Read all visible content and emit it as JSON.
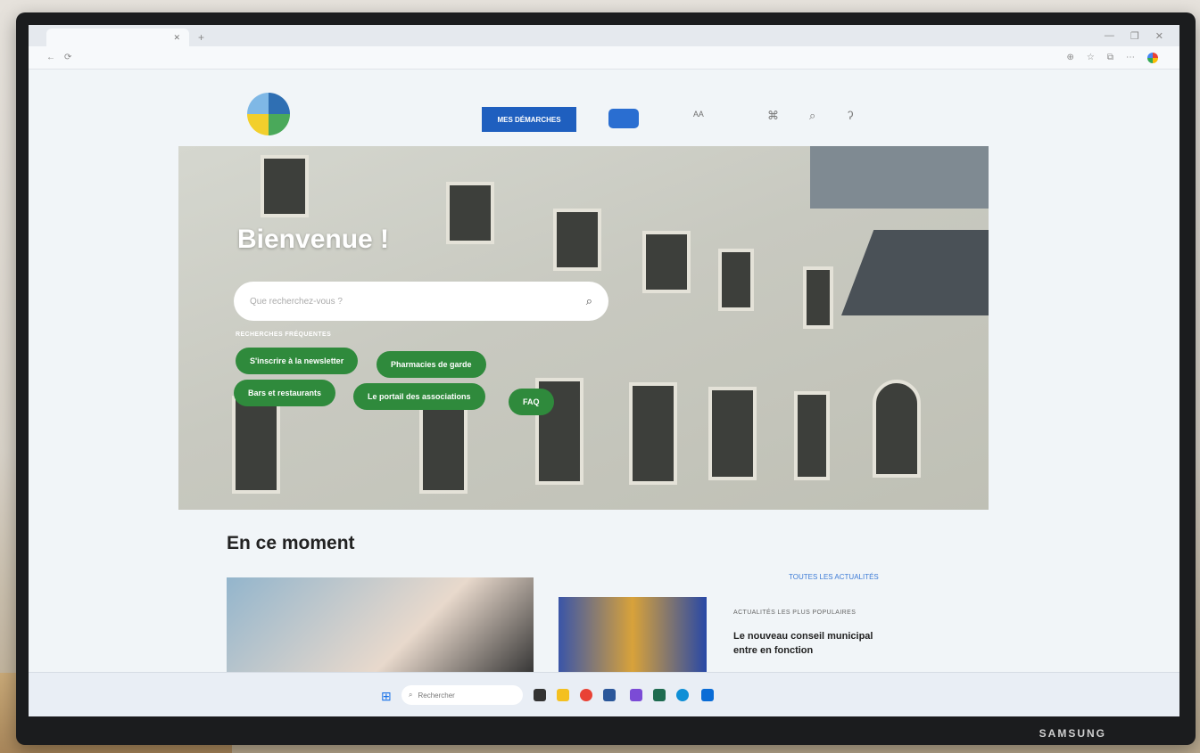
{
  "browser": {
    "tab_title": "",
    "url": "",
    "tab_new": "+",
    "win_controls": [
      "—",
      "❐",
      "✕"
    ],
    "profile_label": ""
  },
  "header": {
    "logo": "city-logo",
    "nav_label": "",
    "primary_button": "MES DÉMARCHES",
    "lang_label": "",
    "icons": [
      "camera-icon",
      "search-icon",
      "ear-icon"
    ]
  },
  "hero": {
    "title": "Bienvenue !",
    "search_placeholder": "Que recherchez-vous ?",
    "frequent_label": "RECHERCHES FRÉQUENTES",
    "pills": [
      "S'inscrire à la newsletter",
      "Pharmacies de garde",
      "Bars et restaurants",
      "Le portail des associations",
      "FAQ"
    ]
  },
  "news": {
    "section_title": "En ce moment",
    "see_all": "TOUTES LES ACTUALITÉS",
    "popular_label": "ACTUALITÉS LES PLUS POPULAIRES",
    "popular_item": "Le nouveau conseil municipal entre en fonction"
  },
  "taskbar": {
    "search_placeholder": "Rechercher",
    "weather_temp": "",
    "weather_desc": "",
    "time": "",
    "date": ""
  },
  "monitor_brand": "SAMSUNG",
  "colors": {
    "primary_blue": "#1f5fbf",
    "pill_green": "#2f8a3c",
    "link_blue": "#3d7bd6"
  }
}
